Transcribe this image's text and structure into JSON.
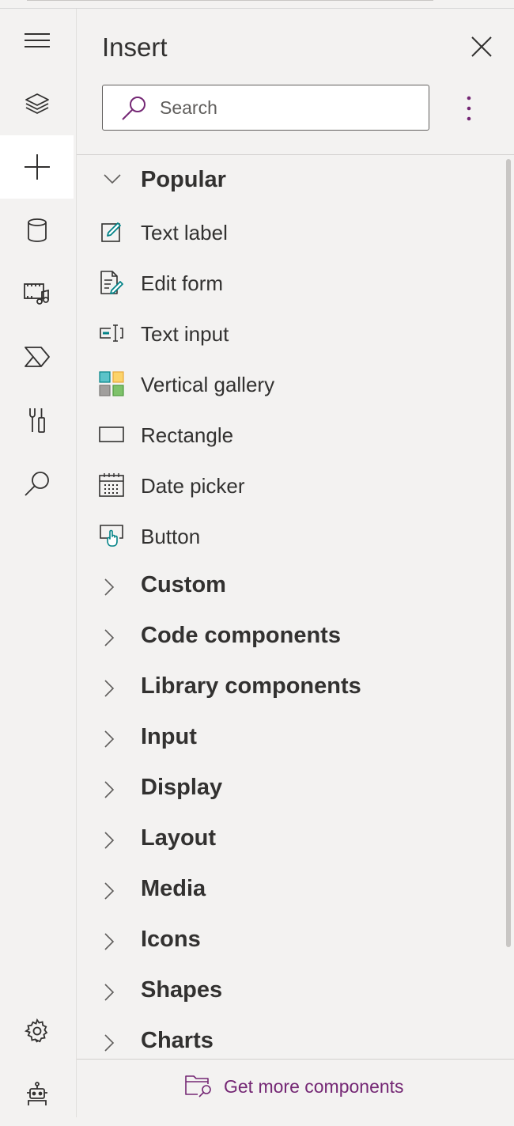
{
  "panel": {
    "title": "Insert",
    "search_placeholder": "Search",
    "accent_color": "#742774"
  },
  "rail": {
    "items": [
      {
        "name": "menu",
        "icon": "hamburger-icon"
      },
      {
        "name": "tree-view",
        "icon": "layers-icon"
      },
      {
        "name": "insert",
        "icon": "plus-icon",
        "active": true
      },
      {
        "name": "data",
        "icon": "database-icon"
      },
      {
        "name": "media",
        "icon": "media-icon"
      },
      {
        "name": "power-automate",
        "icon": "power-automate-icon"
      },
      {
        "name": "advanced-tools",
        "icon": "tools-icon"
      },
      {
        "name": "search",
        "icon": "search-icon"
      },
      {
        "name": "settings",
        "icon": "gear-icon"
      },
      {
        "name": "virtual-agents",
        "icon": "bot-icon"
      }
    ]
  },
  "categories": {
    "popular": "Popular",
    "custom": "Custom",
    "code_components": "Code components",
    "library_components": "Library components",
    "input": "Input",
    "display": "Display",
    "layout": "Layout",
    "media": "Media",
    "icons": "Icons",
    "shapes": "Shapes",
    "charts": "Charts"
  },
  "popular_items": {
    "text_label": "Text label",
    "edit_form": "Edit form",
    "text_input": "Text input",
    "vertical_gallery": "Vertical gallery",
    "rectangle": "Rectangle",
    "date_picker": "Date picker",
    "button": "Button"
  },
  "footer": {
    "get_more_label": "Get more components"
  }
}
